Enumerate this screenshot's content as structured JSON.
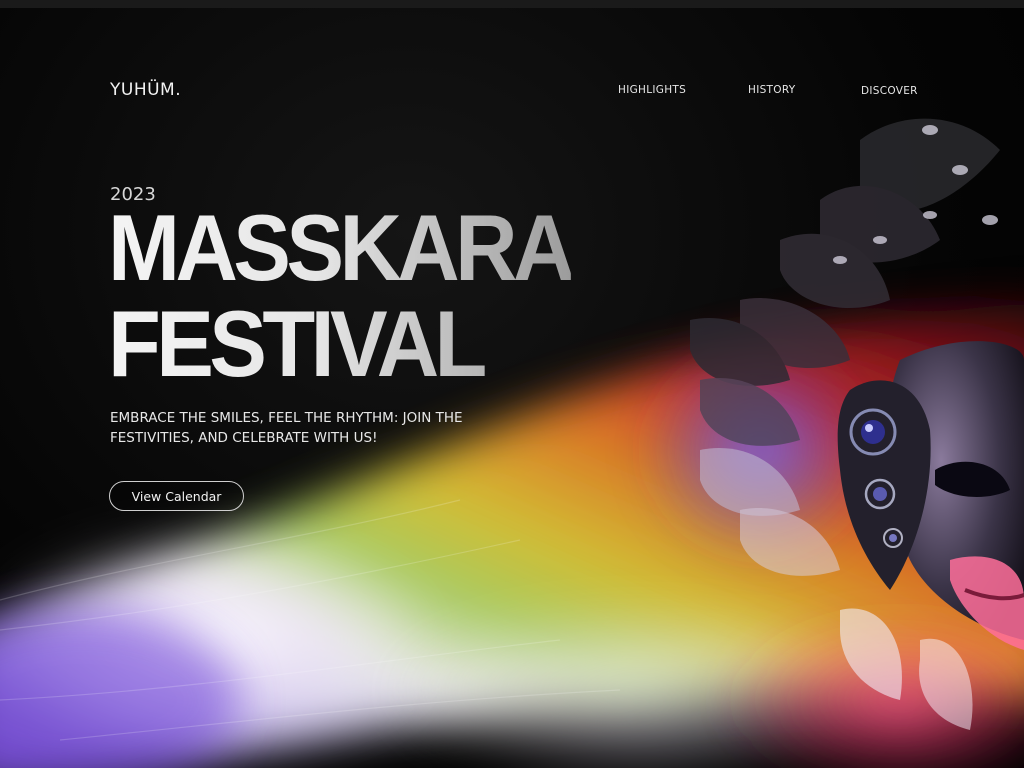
{
  "header": {
    "logo": "YUHÜM.",
    "nav": [
      {
        "label": "HIGHLIGHTS"
      },
      {
        "label": "HISTORY"
      },
      {
        "label": "DISCOVER"
      }
    ]
  },
  "hero": {
    "year": "2023",
    "title_line1": "MASSKARA",
    "title_line2": "FESTIVAL",
    "tagline": "EMBRACE THE SMILES, FEEL THE RHYTHM: JOIN THE FESTIVITIES, AND CELEBRATE WITH US!",
    "cta_label": "View Calendar"
  },
  "colors": {
    "background": "#050505",
    "text": "#eaeaea"
  },
  "icons": {
    "hero_art": "rainbow-light-streak",
    "mask": "carnival-mask-illustration"
  }
}
